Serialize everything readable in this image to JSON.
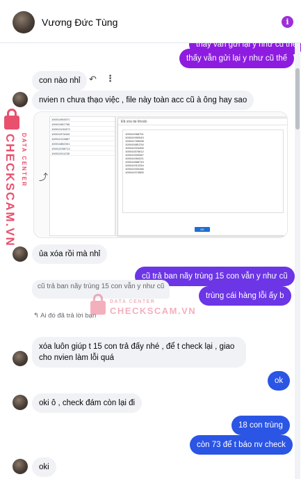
{
  "header": {
    "contact_name": "Vương Đức Tùng",
    "info_icon": "info-icon",
    "accent_color": "#9d2fd9"
  },
  "messages": {
    "cut_off_top": "thấy vẫn gửi lại y như cũ thế",
    "m1": "thấy vẫn gửi lại y như cũ thế",
    "m2": "con nào nhỉ",
    "m3": "nvien n chưa thạo việc , file này toàn acc cũ à ông hay sao",
    "m4": "ủa xóa rồi mà nhỉ",
    "m5": "cũ trả ban nãy trùng 15 con vẫn y như cũ",
    "m6": "trùng cái hàng lỗi ấy b",
    "reply_meta": "↰ Ai đó đã trả lời bạn",
    "quote": "cũ trả ban nãy trùng 15 con vẫn y như cũ",
    "m7": "xóa luôn giúp t 15 con trả đấy nhé , để t check lại , giao cho nvien làm lỗi quá",
    "m8": "ok",
    "m9": "oki ô , check đám còn lại đi",
    "m10": "18 con trùng",
    "m11": "còn 73 để t báo nv check",
    "m12": "oki"
  },
  "attachment": {
    "dialog_title": "Đã xóa tài khoản",
    "dialog_ok": "OK",
    "left_rows": [
      "100011954071",
      "100011987765",
      "100012431872",
      "100011976444",
      "100012115867",
      "100011882341",
      "100012056712",
      "100011911235"
    ],
    "dialog_lines": [
      "100041968791",
      "100041990043",
      "100041765098",
      "100041881234",
      "100041923455",
      "100041876612",
      "100041900087",
      "100041954221",
      "100041888743",
      "100041912334",
      "100041933156",
      "100041974565"
    ]
  },
  "watermark": {
    "line1": "DATA CENTER",
    "line2": "CHECKSCAM.VN"
  },
  "colors": {
    "bubble_in": "#f0f2f5",
    "bubble_purple": "#8d1ce0",
    "bubble_violet": "#6c35e6",
    "bubble_blue": "#2b55e4",
    "watermark": "#e8506e"
  }
}
